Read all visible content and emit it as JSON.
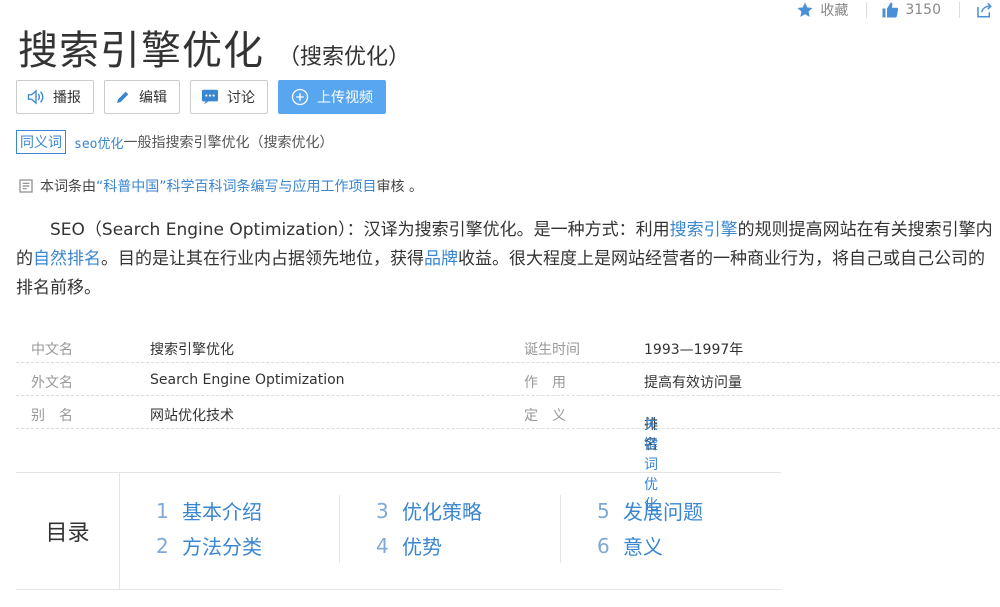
{
  "top_actions": {
    "collect_label": "收藏",
    "like_count": "3150"
  },
  "title": "搜索引擎优化",
  "subtitle": "（搜索优化）",
  "buttons": {
    "broadcast": "播报",
    "edit": "编辑",
    "discuss": "讨论",
    "upload_video": "上传视频"
  },
  "synonym": {
    "tag": "同义词",
    "link": "seo优化",
    "text": "一般指搜索引擎优化（搜索优化）"
  },
  "audit": {
    "prefix": "本词条由",
    "link": "“科普中国”科学百科词条编写与应用工作项目",
    "suffix": " 审核 。"
  },
  "summary": {
    "p1": "SEO（Search Engine Optimization）：汉译为搜索引擎优化。是一种方式：利用",
    "l1": "搜索引擎",
    "p2": "的规则提高网站在有关搜索引擎内的",
    "l2": "自然排名",
    "p3": "。目的是让其在行业内占据领先地位，获得",
    "l3": "品牌",
    "p4": "收益。很大程度上是网站经营者的一种商业行为，将自己或自己公司的排名前移。"
  },
  "info": [
    {
      "k1": "中文名",
      "v1": "搜索引擎优化",
      "k2": "诞生时间",
      "v2": "1993—1997年"
    },
    {
      "k1": "外文名",
      "v1": "Search Engine Optimization",
      "k2": "作　用",
      "v2": "提高有效访问量"
    },
    {
      "k1": "别　名",
      "v1": "网站优化技术",
      "k2": "定　义",
      "v2a": "排名 ",
      "v2b": "关键词优化"
    }
  ],
  "toc": {
    "heading": "目录",
    "items": [
      {
        "num": "1",
        "label": "基本介绍"
      },
      {
        "num": "2",
        "label": "方法分类"
      },
      {
        "num": "3",
        "label": "优化策略"
      },
      {
        "num": "4",
        "label": "优势"
      },
      {
        "num": "5",
        "label": "发展问题"
      },
      {
        "num": "6",
        "label": "意义"
      }
    ]
  },
  "colors": {
    "link": "#3a86d1",
    "primary_button": "#58a6ef",
    "toc_number": "#7fa9d6"
  }
}
